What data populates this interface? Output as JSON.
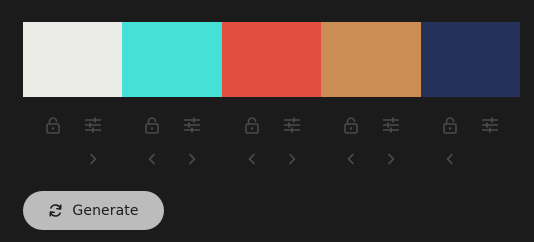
{
  "palette": {
    "colors": [
      {
        "hex": "#EBEBE7",
        "locked": false
      },
      {
        "hex": "#45E0D6",
        "locked": false
      },
      {
        "hex": "#E04F40",
        "locked": false
      },
      {
        "hex": "#CB8D53",
        "locked": false
      },
      {
        "hex": "#263159",
        "locked": false
      }
    ]
  },
  "icons": {
    "lock": "lock-icon",
    "adjust": "sliders-icon",
    "move_left": "chevron-left-icon",
    "move_right": "chevron-right-icon",
    "generate": "refresh-icon"
  },
  "theme": {
    "background": "#1b1b1b",
    "icon_color": "#4a4a4a",
    "button_background": "#bcbcbc",
    "button_text": "#1b1b1b"
  },
  "generate_button": {
    "label": "Generate"
  }
}
